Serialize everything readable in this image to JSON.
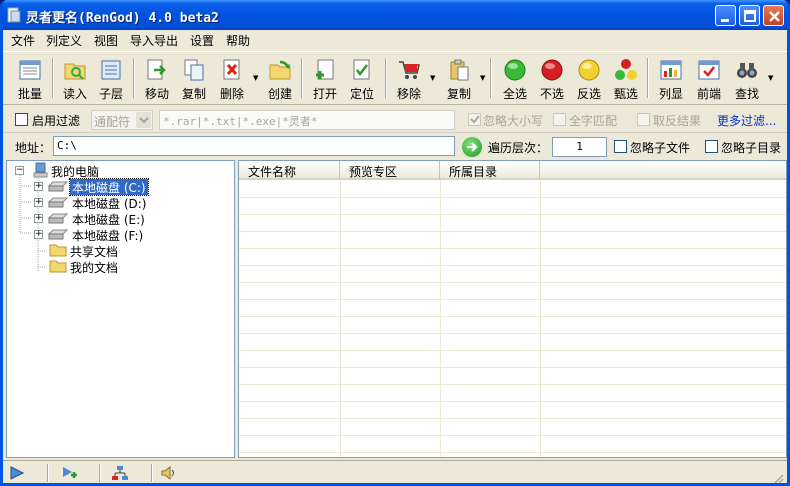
{
  "window": {
    "title": "灵者更名(RenGod) 4.0 beta2"
  },
  "menu": [
    "文件",
    "列定义",
    "视图",
    "导入导出",
    "设置",
    "帮助"
  ],
  "toolbar": {
    "batch": "批量",
    "load": "读入",
    "sub": "子层",
    "move": "移动",
    "copy": "复制",
    "delete": "删除",
    "create": "创建",
    "open": "打开",
    "locate": "定位",
    "remove": "移除",
    "copy2": "复制",
    "select_all": "全选",
    "select_none": "不选",
    "invert": "反选",
    "filter_select": "甄选",
    "columns": "列显",
    "front": "前端",
    "find": "查找"
  },
  "filter": {
    "enable_label": "启用过滤",
    "mode": "通配符",
    "pattern": "*.rar|*.txt|*.exe|*灵者*",
    "ignore_case": "忽略大小写",
    "whole_word": "全字匹配",
    "invert_result": "取反结果",
    "more": "更多过滤..."
  },
  "address": {
    "label": "地址：",
    "value": "C:\\",
    "depth_label": "遍历层次：",
    "depth_value": "1",
    "ignore_files": "忽略子文件",
    "ignore_dirs": "忽略子目录"
  },
  "tree": {
    "root": "我的电脑",
    "drives": [
      "本地磁盘 (C:)",
      "本地磁盘 (D:)",
      "本地磁盘 (E:)",
      "本地磁盘 (F:)"
    ],
    "folders": [
      "共享文档",
      "我的文档"
    ]
  },
  "list": {
    "columns": [
      "文件名称",
      "预览专区",
      "所属目录"
    ]
  }
}
